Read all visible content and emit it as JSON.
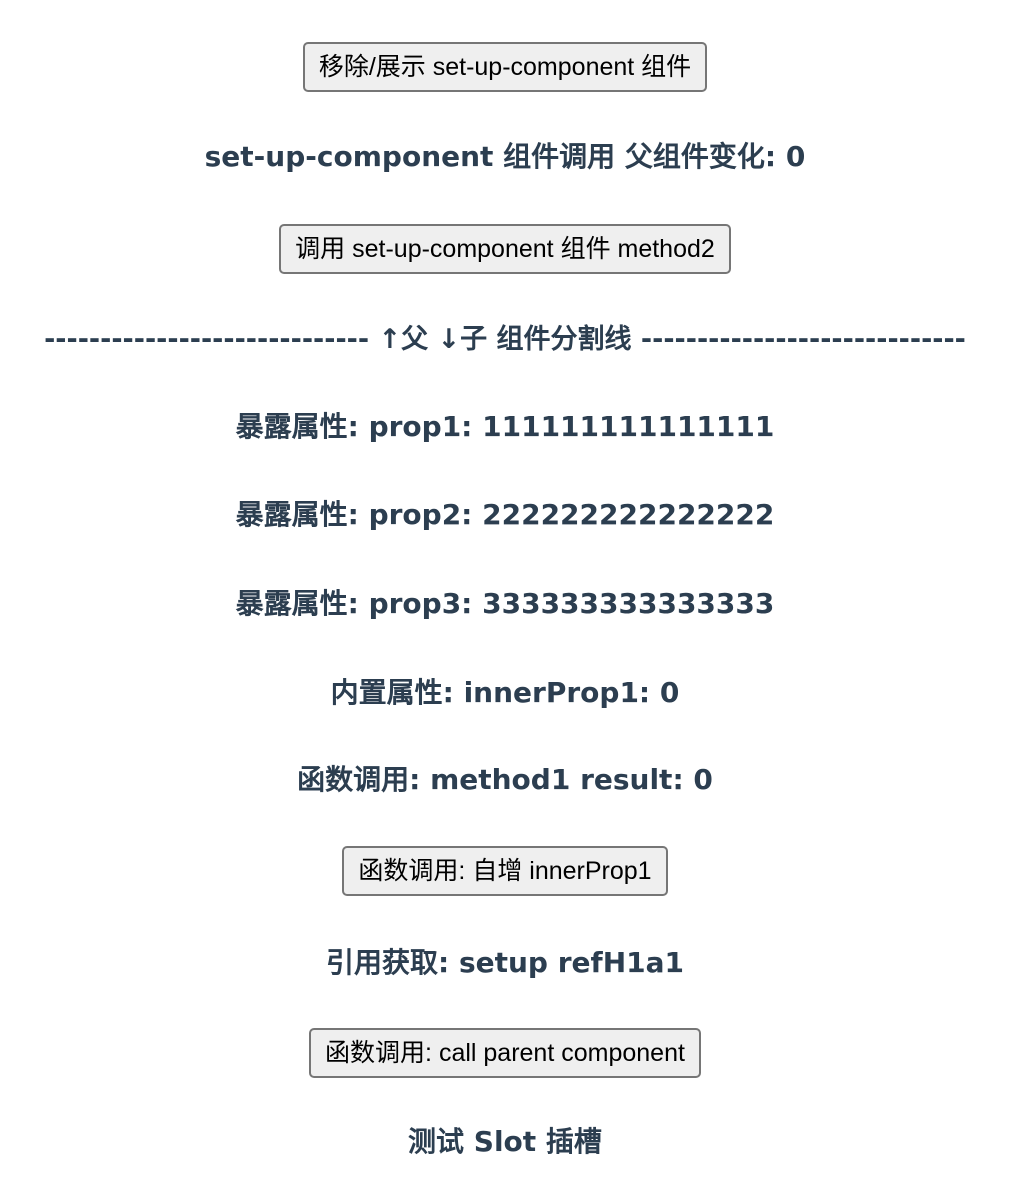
{
  "toggle_button": {
    "label": "移除/展示 set-up-component 组件"
  },
  "parent_status": {
    "text": "set-up-component 组件调用 父组件变化: 0"
  },
  "call_method2_button": {
    "label": "调用 set-up-component 组件 method2"
  },
  "divider": {
    "text": "----------------------------- ↑父 ↓子 组件分割线 -----------------------------"
  },
  "props": [
    {
      "text": "暴露属性: prop1: 111111111111111"
    },
    {
      "text": "暴露属性: prop2: 222222222222222"
    },
    {
      "text": "暴露属性: prop3: 333333333333333"
    }
  ],
  "inner_prop": {
    "text": "内置属性: innerProp1: 0"
  },
  "method1_result": {
    "text": "函数调用: method1 result: 0"
  },
  "increment_button": {
    "label": "函数调用: 自增 innerProp1"
  },
  "ref_text": {
    "text": "引用获取: setup refH1a1"
  },
  "call_parent_button": {
    "label": "函数调用: call parent component"
  },
  "slot_title": {
    "text": "测试 Slot 插槽"
  },
  "colors": {
    "heading": "#2c3e50",
    "button_bg": "#efefef",
    "button_border": "#767676"
  }
}
